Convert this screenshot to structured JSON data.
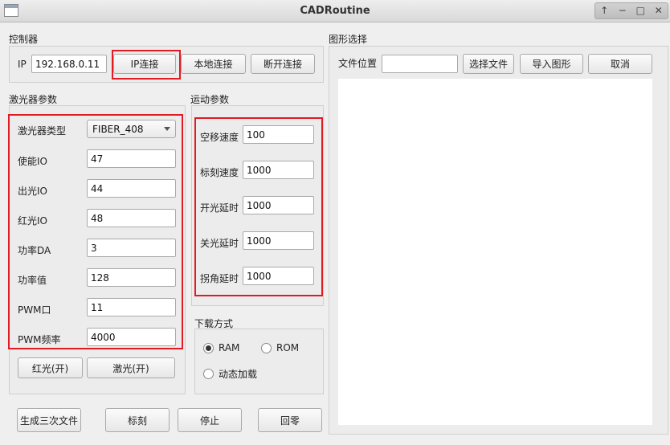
{
  "window": {
    "title": "CADRoutine",
    "controls": [
      "↑",
      "−",
      "□",
      "✕"
    ]
  },
  "controller": {
    "section": "控制器",
    "ip_label": "IP",
    "ip_value": "192.168.0.11",
    "ip_connect": "IP连接",
    "local_connect": "本地连接",
    "disconnect": "断开连接"
  },
  "graphics": {
    "section": "图形选择",
    "file_location_label": "文件位置",
    "file_location_value": "",
    "select_file": "选择文件",
    "import": "导入图形",
    "cancel": "取消"
  },
  "laser": {
    "section": "激光器参数",
    "type_label": "激光器类型",
    "type_value": "FIBER_408",
    "fields": [
      {
        "label": "使能IO",
        "value": "47"
      },
      {
        "label": "出光IO",
        "value": "44"
      },
      {
        "label": "红光IO",
        "value": "48"
      },
      {
        "label": "功率DA",
        "value": "3"
      },
      {
        "label": "功率值",
        "value": "128"
      },
      {
        "label": "PWM口",
        "value": "11"
      },
      {
        "label": "PWM频率",
        "value": "4000"
      }
    ],
    "red_light_button": "红光(开)",
    "laser_button": "激光(开)"
  },
  "motion": {
    "section": "运动参数",
    "fields": [
      {
        "label": "空移速度",
        "value": "100"
      },
      {
        "label": "标刻速度",
        "value": "1000"
      },
      {
        "label": "开光延时",
        "value": "1000"
      },
      {
        "label": "关光延时",
        "value": "1000"
      },
      {
        "label": "拐角延时",
        "value": "1000"
      }
    ]
  },
  "download": {
    "section": "下载方式",
    "options": [
      {
        "label": "RAM",
        "selected": true
      },
      {
        "label": "ROM",
        "selected": false
      },
      {
        "label": "动态加载",
        "selected": false
      }
    ]
  },
  "actions": {
    "generate": "生成三次文件",
    "mark": "标刻",
    "stop": "停止",
    "home": "回零"
  },
  "colors": {
    "highlight": "#e01b24",
    "canvas": "#ffffff",
    "window_bg": "#efefef"
  }
}
